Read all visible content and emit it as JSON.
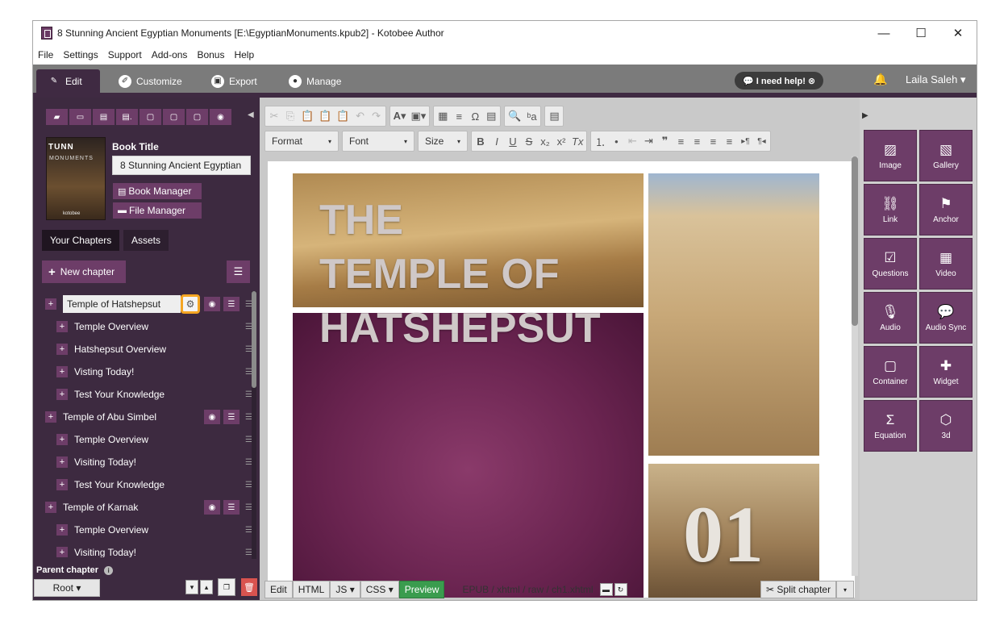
{
  "window": {
    "title": "8 Stunning Ancient Egyptian Monuments [E:\\EgyptianMonuments.kpub2] - Kotobee Author",
    "controls": {
      "minimize": "—",
      "maximize": "☐",
      "close": "✕"
    }
  },
  "menu": [
    "File",
    "Settings",
    "Support",
    "Add-ons",
    "Bonus",
    "Help"
  ],
  "tabs": [
    {
      "label": "Edit",
      "icon": "pencil-icon",
      "glyph": "✎"
    },
    {
      "label": "Customize",
      "icon": "brush-icon",
      "glyph": "✐"
    },
    {
      "label": "Export",
      "icon": "export-icon",
      "glyph": "▣"
    },
    {
      "label": "Manage",
      "icon": "user-icon",
      "glyph": "●"
    }
  ],
  "help_button": "💬 I need help! ⊗",
  "user": {
    "name": "Laila Saleh ▾",
    "bell": "🔔"
  },
  "sidebar": {
    "toolbar_icons": [
      "▰",
      "▭",
      "▤",
      "▤.",
      "▢",
      "▢",
      "▢",
      "◉"
    ],
    "collapse_arrow": "◀",
    "cover": {
      "text1": "TUNN",
      "text2": "MONUMENTS",
      "brand": "kotobee"
    },
    "book_title_label": "Book Title",
    "book_title_value": "8 Stunning Ancient Egyptian",
    "book_manager": "Book Manager",
    "file_manager": "File Manager",
    "book_manager_icon": "▤",
    "file_manager_icon": "▬",
    "tab_chapters": "Your Chapters",
    "tab_assets": "Assets",
    "new_chapter": "New chapter",
    "new_chapter_plus": "+",
    "menu_glyph": "☰",
    "chapters": [
      {
        "label": "Temple of Hatshepsut",
        "level": 0,
        "selected": true
      },
      {
        "label": "Temple Overview",
        "level": 1
      },
      {
        "label": "Hatshepsut Overview",
        "level": 1
      },
      {
        "label": "Visting Today!",
        "level": 1
      },
      {
        "label": "Test Your Knowledge",
        "level": 1
      },
      {
        "label": "Temple of Abu Simbel",
        "level": 0
      },
      {
        "label": "Temple Overview",
        "level": 1
      },
      {
        "label": "Visiting Today!",
        "level": 1
      },
      {
        "label": "Test Your Knowledge",
        "level": 1
      },
      {
        "label": "Temple of Karnak",
        "level": 0
      },
      {
        "label": "Temple Overview",
        "level": 1
      },
      {
        "label": "Visiting Today!",
        "level": 1
      }
    ],
    "row_glyphs": {
      "plus": "+",
      "gear": "⚙",
      "eye": "◉",
      "menu": "☰",
      "grip": "☰"
    },
    "parent_chapter_label": "Parent chapter",
    "info_glyph": "i",
    "root_button": "Root ▾",
    "bottom_icons": {
      "down": "▾",
      "up": "▴",
      "copy": "❐",
      "delete": "🗑"
    }
  },
  "editor": {
    "toolbar_row1": [
      [
        "✂",
        "⎘",
        "📋",
        "📋",
        "📋"
      ],
      [
        "↶",
        "↷"
      ],
      [
        "A▾",
        "▣▾"
      ],
      [
        "▦",
        "≡",
        "Ω",
        "▤"
      ],
      [
        "🔍",
        "ᵇa"
      ],
      [
        "▤"
      ]
    ],
    "toolbar_row2": {
      "format": "Format",
      "font": "Font",
      "size": "Size",
      "caret": "▾",
      "inline": [
        "B",
        "I",
        "U",
        "S",
        "x₂",
        "x²",
        "Tx"
      ],
      "lists": [
        "⒈",
        "•"
      ],
      "indent": [
        "⇤",
        "⇥",
        "❞"
      ],
      "align": [
        "≡",
        "≡",
        "≡",
        "≡"
      ],
      "dir": [
        "▸¶",
        "¶◂"
      ]
    },
    "document": {
      "headline": [
        "THE",
        "TEMPLE OF",
        "HATSHEPSUT"
      ],
      "number": "01"
    },
    "bottom": {
      "buttons": [
        "Edit",
        "HTML",
        "JS ▾",
        "CSS ▾",
        "Preview"
      ],
      "path": "EPUB / xhtml / raw / ch1.xhtml",
      "folder_icon": "▬",
      "refresh_icon": "↻",
      "split_chapter": "✂ Split chapter",
      "split_caret": "▾"
    }
  },
  "right_panel": {
    "arrow": "▶",
    "widgets": [
      {
        "label": "Image",
        "icon": "image-icon",
        "glyph": "▨"
      },
      {
        "label": "Gallery",
        "icon": "gallery-icon",
        "glyph": "▧"
      },
      {
        "label": "Link",
        "icon": "link-icon",
        "glyph": "⛓"
      },
      {
        "label": "Anchor",
        "icon": "flag-icon",
        "glyph": "⚑"
      },
      {
        "label": "Questions",
        "icon": "checkbox-icon",
        "glyph": "☑"
      },
      {
        "label": "Video",
        "icon": "film-icon",
        "glyph": "▦"
      },
      {
        "label": "Audio",
        "icon": "microphone-icon",
        "glyph": "🎙"
      },
      {
        "label": "Audio Sync",
        "icon": "speech-icon",
        "glyph": "💬"
      },
      {
        "label": "Container",
        "icon": "container-icon",
        "glyph": "▢"
      },
      {
        "label": "Widget",
        "icon": "puzzle-icon",
        "glyph": "✚"
      },
      {
        "label": "Equation",
        "icon": "sigma-icon",
        "glyph": "Σ"
      },
      {
        "label": "3d",
        "icon": "cube-icon",
        "glyph": "⬡"
      }
    ]
  }
}
